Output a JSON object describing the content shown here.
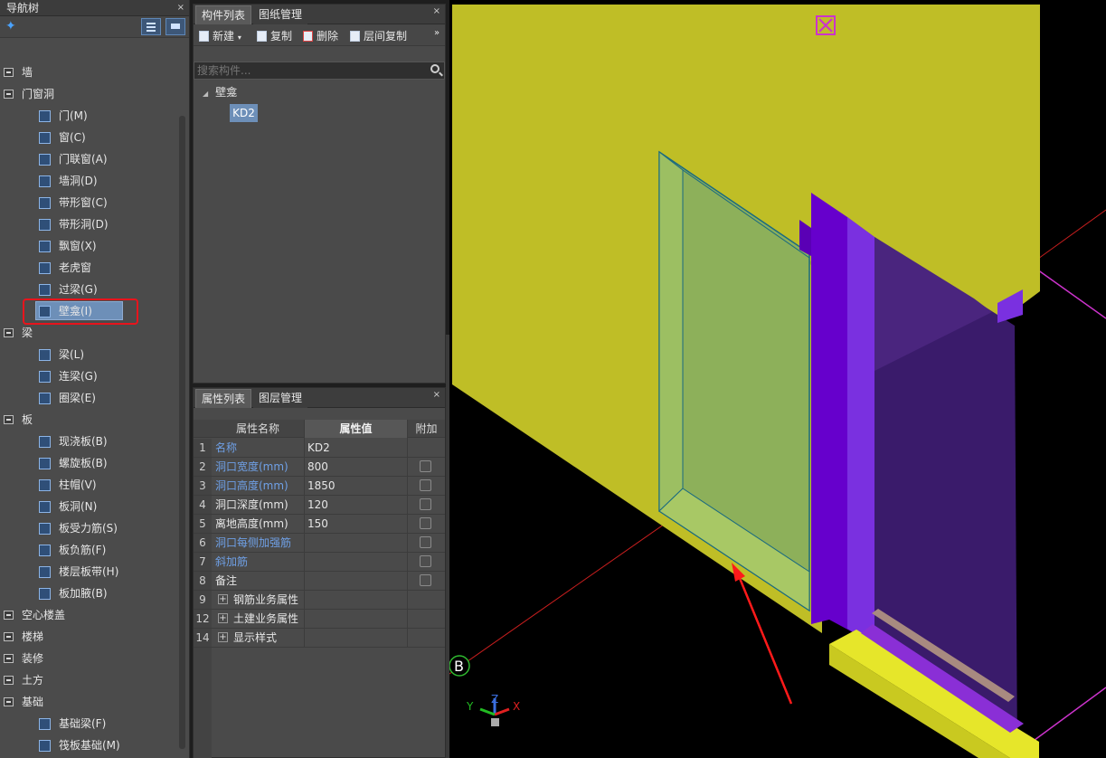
{
  "nav": {
    "title": "导航树",
    "close": "×",
    "add_icon": "add-sparkle-icon",
    "categories": [
      {
        "label": "墙",
        "state": "collapsed"
      },
      {
        "label": "门窗洞",
        "state": "expanded",
        "items": [
          {
            "label": "门(M)",
            "icon": "door-icon"
          },
          {
            "label": "窗(C)",
            "icon": "window-icon"
          },
          {
            "label": "门联窗(A)",
            "icon": "door-window-icon"
          },
          {
            "label": "墙洞(D)",
            "icon": "wall-hole-icon"
          },
          {
            "label": "带形窗(C)",
            "icon": "strip-window-icon"
          },
          {
            "label": "带形洞(D)",
            "icon": "strip-hole-icon"
          },
          {
            "label": "飘窗(X)",
            "icon": "bay-window-icon"
          },
          {
            "label": "老虎窗",
            "icon": "dormer-icon"
          },
          {
            "label": "过梁(G)",
            "icon": "lintel-icon"
          },
          {
            "label": "壁龛(I)",
            "icon": "niche-icon",
            "selected": true
          }
        ]
      },
      {
        "label": "梁",
        "state": "expanded",
        "items": [
          {
            "label": "梁(L)",
            "icon": "beam-icon"
          },
          {
            "label": "连梁(G)",
            "icon": "coupling-beam-icon"
          },
          {
            "label": "圈梁(E)",
            "icon": "ring-beam-icon"
          }
        ]
      },
      {
        "label": "板",
        "state": "expanded",
        "items": [
          {
            "label": "现浇板(B)",
            "icon": "slab-icon"
          },
          {
            "label": "螺旋板(B)",
            "icon": "spiral-slab-icon"
          },
          {
            "label": "柱帽(V)",
            "icon": "column-cap-icon"
          },
          {
            "label": "板洞(N)",
            "icon": "slab-hole-icon"
          },
          {
            "label": "板受力筋(S)",
            "icon": "slab-rebar-icon"
          },
          {
            "label": "板负筋(F)",
            "icon": "negative-rebar-icon"
          },
          {
            "label": "楼层板带(H)",
            "icon": "slab-strip-icon"
          },
          {
            "label": "板加腋(B)",
            "icon": "haunch-icon"
          }
        ]
      },
      {
        "label": "空心楼盖",
        "state": "collapsed"
      },
      {
        "label": "楼梯",
        "state": "collapsed"
      },
      {
        "label": "装修",
        "state": "collapsed"
      },
      {
        "label": "土方",
        "state": "collapsed"
      },
      {
        "label": "基础",
        "state": "expanded",
        "items": [
          {
            "label": "基础梁(F)",
            "icon": "foundation-beam-icon"
          },
          {
            "label": "筏板基础(M)",
            "icon": "raft-foundation-icon"
          }
        ]
      }
    ]
  },
  "components": {
    "tabs": [
      "构件列表",
      "图纸管理"
    ],
    "close": "×",
    "toolbar": {
      "new": "新建",
      "copy": "复制",
      "delete": "删除",
      "floor_copy": "层间复制",
      "more": "»"
    },
    "search_placeholder": "搜索构件...",
    "tree": {
      "category": "壁龛",
      "items": [
        "KD2"
      ]
    }
  },
  "properties": {
    "tabs": [
      "属性列表",
      "图层管理"
    ],
    "close": "×",
    "headers": {
      "name": "属性名称",
      "value": "属性值",
      "extra": "附加"
    },
    "rows": [
      {
        "num": "1",
        "name": "名称",
        "value": "KD2",
        "blue": true,
        "checkbox": false
      },
      {
        "num": "2",
        "name": "洞口宽度(mm)",
        "value": "800",
        "blue": true,
        "checkbox": true
      },
      {
        "num": "3",
        "name": "洞口高度(mm)",
        "value": "1850",
        "blue": true,
        "checkbox": true
      },
      {
        "num": "4",
        "name": "洞口深度(mm)",
        "value": "120",
        "blue": false,
        "checkbox": true
      },
      {
        "num": "5",
        "name": "离地高度(mm)",
        "value": "150",
        "blue": false,
        "checkbox": true
      },
      {
        "num": "6",
        "name": "洞口每侧加强筋",
        "value": "",
        "blue": true,
        "checkbox": true
      },
      {
        "num": "7",
        "name": "斜加筋",
        "value": "",
        "blue": true,
        "checkbox": true
      },
      {
        "num": "8",
        "name": "备注",
        "value": "",
        "blue": false,
        "checkbox": true
      }
    ],
    "groups": [
      {
        "num": "9",
        "name": "钢筋业务属性"
      },
      {
        "num": "12",
        "name": "土建业务属性"
      },
      {
        "num": "14",
        "name": "显示样式"
      }
    ]
  },
  "viewport": {
    "axis_marker": "B",
    "axes": {
      "x": "X",
      "y": "Y",
      "z": "Z"
    },
    "colors": {
      "wall": "#bfbe26",
      "niche": "#8db05a",
      "column": "#6600cc",
      "slab": "#e6e62a",
      "arrow": "#ff1a1a"
    }
  }
}
